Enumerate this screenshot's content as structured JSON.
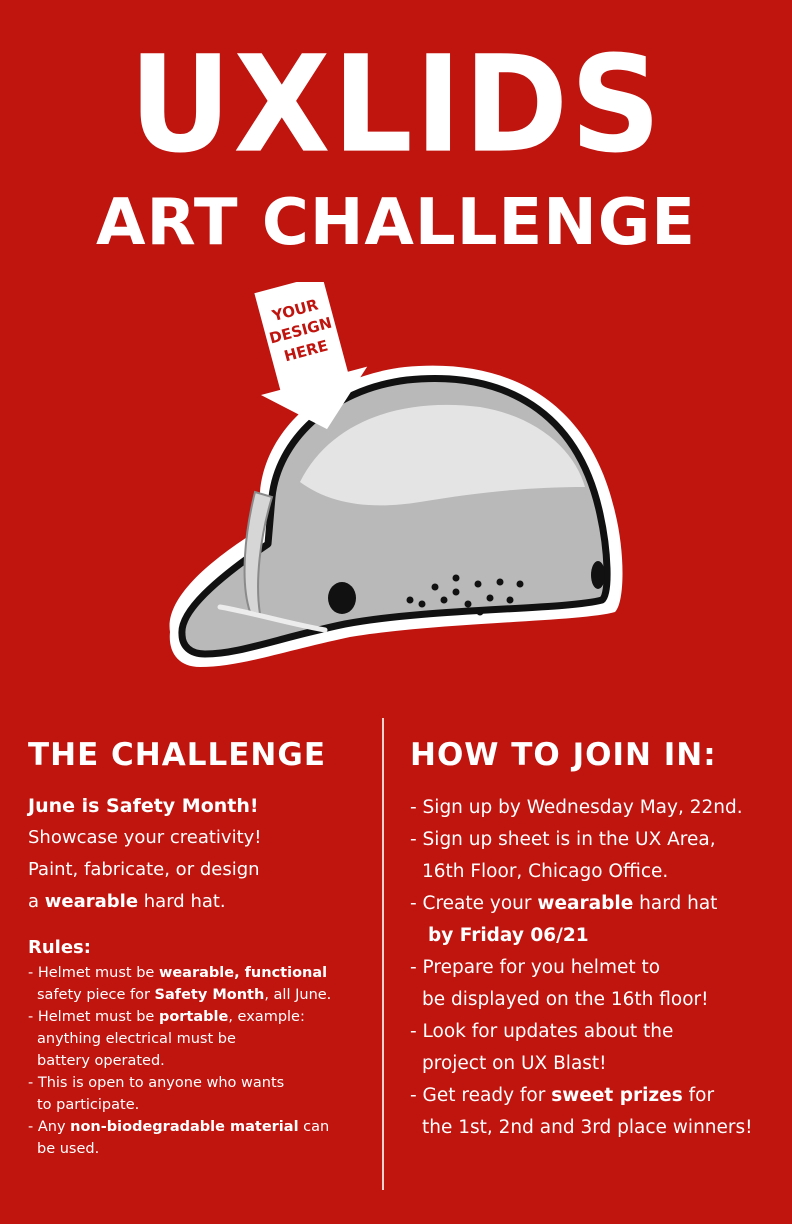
{
  "title": "UXLIDS",
  "subtitle": "ART CHALLENGE",
  "arrow_label": [
    "YOUR",
    "DESIGN",
    "HERE"
  ],
  "colors": {
    "background": "#c0140f",
    "text": "#ffffff",
    "helmet": "#b9b9b9"
  },
  "challenge": {
    "heading": "THE CHALLENGE",
    "lead": "June is Safety Month!",
    "line1": "Showcase your creativity!",
    "line2": "Paint, fabricate, or design",
    "line3_pre": "a ",
    "line3_bold": "wearable",
    "line3_post": " hard hat.",
    "rules_heading": "Rules:",
    "rules": {
      "r1a_pre": "- Helmet must be ",
      "r1a_bold": "wearable, functional",
      "r1b_pre": "safety piece for ",
      "r1b_bold": "Safety Month",
      "r1b_post": ", all June.",
      "r2a_pre": "- Helmet must be ",
      "r2a_bold": "portable",
      "r2a_post": ", example:",
      "r2b": "anything electrical must be",
      "r2c": "battery operated.",
      "r3a": "- This is open to anyone who wants",
      "r3b": "to participate.",
      "r4a_pre": "- Any ",
      "r4a_bold": "non-biodegradable material",
      "r4a_post": " can",
      "r4b": "be used."
    }
  },
  "join": {
    "heading": "HOW TO JOIN IN:",
    "i1": "- Sign up by Wednesday May, 22nd.",
    "i2a": "- Sign up sheet is in the UX Area,",
    "i2b": "16th Floor, Chicago Office.",
    "i3a_pre": "- Create your ",
    "i3a_bold": "wearable",
    "i3a_post": " hard hat",
    "i3b_bold": "by Friday 06/21",
    "i4a": "- Prepare for you helmet to",
    "i4b": "be displayed on the 16th floor!",
    "i5a": "- Look for updates about the",
    "i5b": "project on UX Blast!",
    "i6a_pre": "- Get ready for ",
    "i6a_bold": "sweet prizes",
    "i6a_post": " for",
    "i6b": "the 1st, 2nd and 3rd place winners!"
  }
}
